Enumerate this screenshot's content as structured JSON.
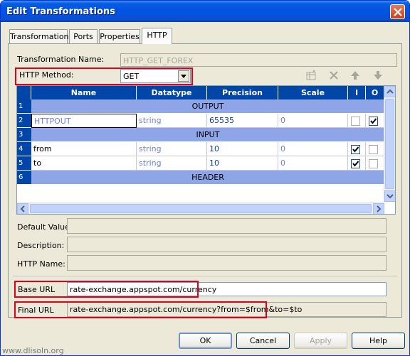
{
  "window": {
    "title": "Edit Transformations"
  },
  "tabs": [
    "Transformation",
    "Ports",
    "Properties",
    "HTTP"
  ],
  "active_tab": "HTTP",
  "transformation_name": {
    "label": "Transformation Name:",
    "value": "HTTP_GET_FOREX"
  },
  "http_method": {
    "label": "HTTP Method:",
    "value": "GET"
  },
  "grid": {
    "headers": [
      "Name",
      "Datatype",
      "Precision",
      "Scale",
      "I",
      "O"
    ],
    "rows": [
      {
        "num": "1",
        "type": "group",
        "label": "OUTPUT"
      },
      {
        "num": "2",
        "type": "port",
        "name": "HTTPOUT",
        "datatype": "string",
        "precision": "65535",
        "scale": "0",
        "input": false,
        "output": true
      },
      {
        "num": "3",
        "type": "group",
        "label": "INPUT"
      },
      {
        "num": "4",
        "type": "port",
        "name": "from",
        "datatype": "string",
        "precision": "10",
        "scale": "0",
        "input": true,
        "output": false
      },
      {
        "num": "5",
        "type": "port",
        "name": "to",
        "datatype": "string",
        "precision": "10",
        "scale": "0",
        "input": true,
        "output": false
      },
      {
        "num": "6",
        "type": "group",
        "label": "HEADER"
      }
    ]
  },
  "fields": {
    "default_value": "Default Value:",
    "description": "Description:",
    "http_name": "HTTP Name:",
    "base_url_label": "Base URL",
    "base_url": "rate-exchange.appspot.com/currency",
    "final_url_label": "Final URL",
    "final_url": "rate-exchange.appspot.com/currency?from=$from&to=$to"
  },
  "buttons": {
    "ok": "OK",
    "cancel": "Cancel",
    "apply": "Apply",
    "help": "Help"
  },
  "watermark": "www.dlisoln.org",
  "icons": [
    "new-port-icon",
    "delete-icon",
    "move-up-icon",
    "move-down-icon",
    "close-icon",
    "dropdown-arrow-icon",
    "checkbox"
  ],
  "colors": {
    "title_bar": "#0054e3",
    "grid_header": "#0046a8",
    "group_row": "#8ea6e8",
    "highlight": "#e0001b"
  }
}
